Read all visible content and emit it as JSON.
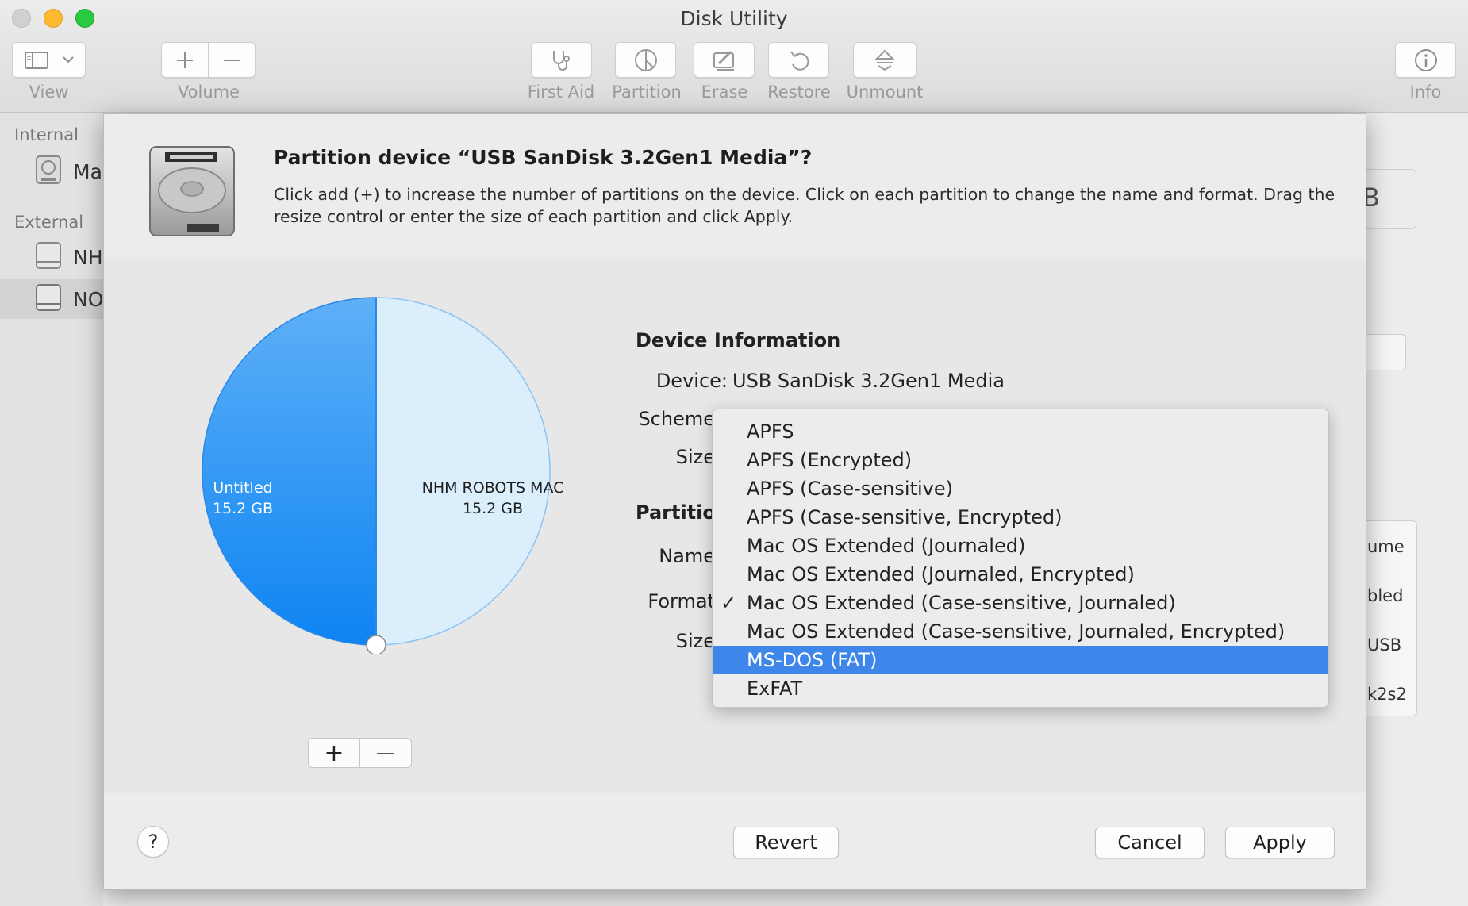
{
  "window": {
    "title": "Disk Utility"
  },
  "toolbar": {
    "view_label": "View",
    "volume_label": "Volume",
    "first_aid_label": "First Aid",
    "partition_label": "Partition",
    "erase_label": "Erase",
    "restore_label": "Restore",
    "unmount_label": "Unmount",
    "info_label": "Info"
  },
  "sidebar": {
    "internal_header": "Internal",
    "external_header": "External",
    "items": [
      {
        "label": "Ma"
      },
      {
        "label": "NH"
      },
      {
        "label": "NO"
      }
    ]
  },
  "background": {
    "capacity_fragment": "B",
    "row1": "ume",
    "row2": "bled",
    "row3": "USB",
    "row4": "k2s2"
  },
  "sheet": {
    "title": "Partition device “USB SanDisk 3.2Gen1 Media”?",
    "description": "Click add (+) to increase the number of partitions on the device. Click on each partition to change the name and format. Drag the resize control or enter the size of each partition and click Apply."
  },
  "chart_data": {
    "type": "pie",
    "slices": [
      {
        "name": "Untitled",
        "size_label": "15.2 GB",
        "value": 15.2,
        "color": "#2f93f5"
      },
      {
        "name": "NHM ROBOTS MAC",
        "size_label": "15.2 GB",
        "value": 15.2,
        "color": "#dbeefc"
      }
    ]
  },
  "partition_buttons": {
    "add": "+",
    "remove": "—"
  },
  "device_info": {
    "heading": "Device Information",
    "device_label": "Device:",
    "device_value": "USB SanDisk 3.2Gen1 Media",
    "scheme_label": "Scheme",
    "size_label": "Size"
  },
  "partition_info": {
    "heading": "Partitio",
    "name_label": "Name",
    "format_label": "Format",
    "size_label": "Size"
  },
  "format_menu": {
    "checked_index": 6,
    "highlighted_index": 8,
    "items": [
      "APFS",
      "APFS (Encrypted)",
      "APFS (Case-sensitive)",
      "APFS (Case-sensitive, Encrypted)",
      "Mac OS Extended (Journaled)",
      "Mac OS Extended (Journaled, Encrypted)",
      "Mac OS Extended (Case-sensitive, Journaled)",
      "Mac OS Extended (Case-sensitive, Journaled, Encrypted)",
      "MS-DOS (FAT)",
      "ExFAT"
    ]
  },
  "buttons": {
    "help": "?",
    "revert": "Revert",
    "cancel": "Cancel",
    "apply": "Apply"
  },
  "colors": {
    "accent": "#3f86ea",
    "partition_primary": "#2f93f5",
    "partition_secondary": "#dbeefc"
  }
}
